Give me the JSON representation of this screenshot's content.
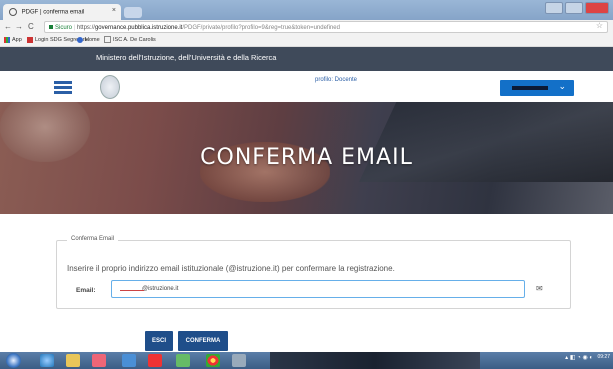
{
  "browser": {
    "tab_title": "PDGF | conferma email",
    "tab_close": "×",
    "nav_back": "←",
    "nav_forward": "→",
    "nav_reload": "C",
    "secure_label": "Sicuro",
    "url_scheme": "https://",
    "url_host": "governance.pubblica.istruzione.it",
    "url_path": "/PDGF/private/profilo?profilo=9&reg=true&token=undefined",
    "star": "☆",
    "bookmarks": [
      "App",
      "Login SDG Segreteria",
      "Home",
      "ISC A. De Carolis"
    ]
  },
  "site": {
    "ministry_title": "Ministero dell'Istruzione, dell'Università e della Ricerca",
    "profile_label": "profilo: Docente",
    "dropdown_chevron": "⌄",
    "hero_title": "CONFERMA EMAIL"
  },
  "form": {
    "legend": "Conferma Email",
    "instruction": "Inserire il proprio indirizzo email istituzionale (@istruzione.it) per confermare la registrazione.",
    "email_label": "Email:",
    "email_value": "@istruzione.it",
    "envelope": "✉",
    "esci_label": "ESCI",
    "conferma_label": "CONFERMA"
  },
  "taskbar": {
    "clock_time": "09:27"
  },
  "colors": {
    "accent": "#1370c8",
    "header_dark": "#3f4a5a",
    "button_blue": "#1f4e8a"
  }
}
